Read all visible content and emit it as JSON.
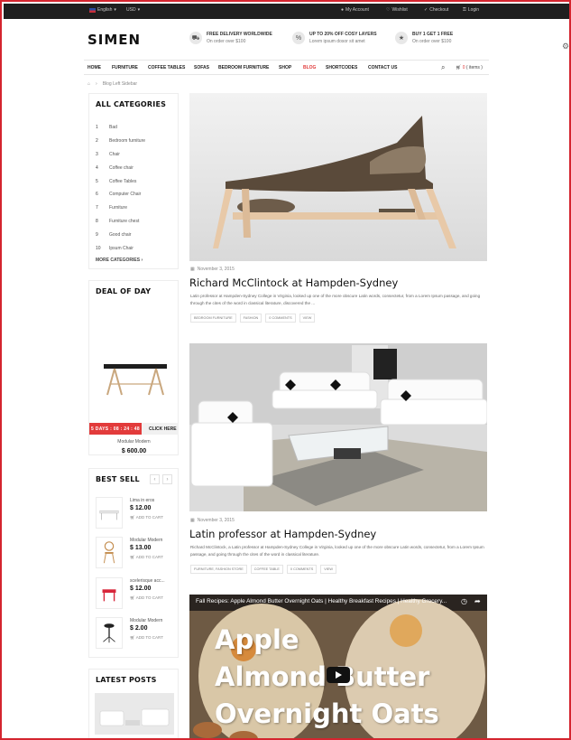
{
  "topbar": {
    "language": "English",
    "currency": "USD",
    "links": [
      "My Account",
      "Wishlist",
      "Checkout",
      "Login"
    ]
  },
  "header": {
    "logo": "SIMEN",
    "promos": [
      {
        "title": "FREE DELIVERY WORLDWIDE",
        "subtitle": "On order over $100"
      },
      {
        "title": "UP TO 20% OFF COSY LAYERS",
        "subtitle": "Lorem ipsum dosor sit amet"
      },
      {
        "title": "BUY 1 GET 1 FREE",
        "subtitle": "On order over $100"
      }
    ]
  },
  "nav": {
    "items": [
      "HOME",
      "FURNITURE",
      "COFFEE TABLES",
      "SOFAS",
      "BEDROOM FURNITURE",
      "SHOP",
      "BLOG",
      "SHORTCODES",
      "CONTACT US"
    ],
    "active": "BLOG",
    "cart_count": "0",
    "cart_label": "( items )"
  },
  "breadcrumb": {
    "current": "Blog Left Sidebar"
  },
  "sidebar": {
    "categories_title": "ALL CATEGORIES",
    "categories": [
      {
        "num": "1",
        "label": "Bad"
      },
      {
        "num": "2",
        "label": "Bedroom furniture"
      },
      {
        "num": "3",
        "label": "Chair"
      },
      {
        "num": "4",
        "label": "Coffee chair"
      },
      {
        "num": "5",
        "label": "Coffee Tables"
      },
      {
        "num": "6",
        "label": "Computer Chair"
      },
      {
        "num": "7",
        "label": "Furniture"
      },
      {
        "num": "8",
        "label": "Furniture chest"
      },
      {
        "num": "9",
        "label": "Good chair"
      },
      {
        "num": "10",
        "label": "Ipsum Chair"
      }
    ],
    "more_categories": "MORE CATEGORIES",
    "deal_title": "DEAL OF DAY",
    "deal_timer": "5 DAYS : 08 : 24 : 48",
    "deal_buy": "CLICK HERE",
    "deal_name": "Modular Modern",
    "deal_price": "$ 600.00",
    "bestsell_title": "BEST SELL",
    "bestsell": [
      {
        "name": "Lima in eros",
        "price": "$ 12.00",
        "cart": "ADD TO CART"
      },
      {
        "name": "Modular Modern",
        "price": "$ 13.00",
        "cart": "ADD TO CART"
      },
      {
        "name": "scelerisque acc...",
        "price": "$ 12.00",
        "cart": "ADD TO CART"
      },
      {
        "name": "Modular Modern",
        "price": "$ 2.00",
        "cart": "ADD TO CART"
      }
    ],
    "latest_title": "LATEST POSTS"
  },
  "posts": [
    {
      "date": "November 3, 2015",
      "title": "Richard McClintock at Hampden-Sydney",
      "excerpt": "Latin professor at Hampden-Sydney College in Virginia, looked up one of the more obscure Latin words, consectetur, from a Lorem Ipsum passage, and going through the cites of the word in classical literature, discovered the ...",
      "tags": [
        "BEDROOM FURNITURE",
        "FASHION",
        "0 COMMENTS",
        "VIEW"
      ]
    },
    {
      "date": "November 3, 2015",
      "title": "Latin professor at Hampden-Sydney",
      "excerpt": "Richard McClintock, a Latin professor at Hampden-Sydney College in Virginia, looked up one of the more obscure Latin words, consectetur, from a Lorem Ipsum passage, and going through the cites of the word in classical literature.",
      "tags": [
        "FURNITURE, FASHION STORE",
        "COFFEE TABLE",
        "0 COMMENTS",
        "VIEW"
      ]
    }
  ],
  "video": {
    "title": "Fall Recipes: Apple Almond Butter Overnight Oats | Healthy Breakfast Recipes | Healthy Grocery...",
    "overlay_lines": [
      "Apple",
      "Almond Butter",
      "Overnight Oats"
    ]
  },
  "colors": {
    "accent": "#e03a3a",
    "topbar": "#1f1f1f",
    "frame": "#d4252f"
  }
}
